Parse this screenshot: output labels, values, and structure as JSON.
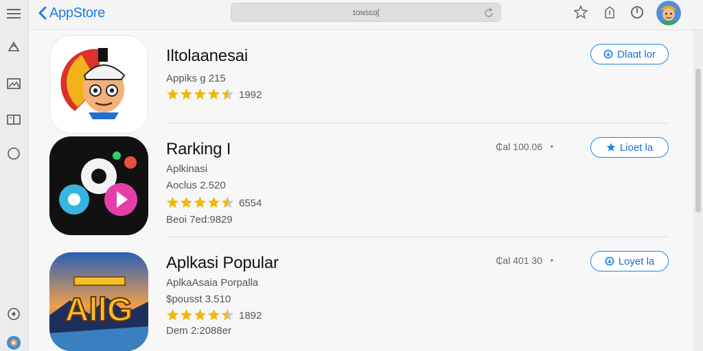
{
  "header": {
    "back_label": "AppStore",
    "back_sub": "Back",
    "search_text": "ɪoɴsɛɑʃ",
    "icons": [
      "star-icon",
      "share-icon",
      "power-icon"
    ]
  },
  "sidebar": {
    "icons": [
      "menu-icon",
      "recycle-icon",
      "image-icon",
      "book-icon",
      "circle-icon",
      "play-circle-icon",
      "app-avatar-icon"
    ]
  },
  "apps": [
    {
      "title": "Iltolaanesai",
      "line1": "Appiks ɡ 215",
      "rating": "4.5",
      "count": "1992",
      "price": "",
      "button": "Dlaɑt lor",
      "button_icon": "download-icon"
    },
    {
      "title": "Rarking I",
      "line1": "Aplkinasi",
      "line2": "Aoclus 2.520",
      "rating": "4.5",
      "count": "6554",
      "line3": "Beoi 7ed:9829",
      "price": "₵al 100.06",
      "button": "Lioet la",
      "button_icon": "star-icon"
    },
    {
      "title": "Aplkasi Popular",
      "line1": "AplkaAsaia Porpalla",
      "line2": "$pousst 3.510",
      "rating": "4.5",
      "count": "1892",
      "line3": "Dem 2:2088er",
      "price": "₵al 401 30",
      "button": "Loyet la",
      "button_icon": "download-icon"
    }
  ],
  "colors": {
    "accent": "#1a85e8",
    "star": "#f2b705",
    "text": "#111111",
    "muted": "#555555"
  }
}
